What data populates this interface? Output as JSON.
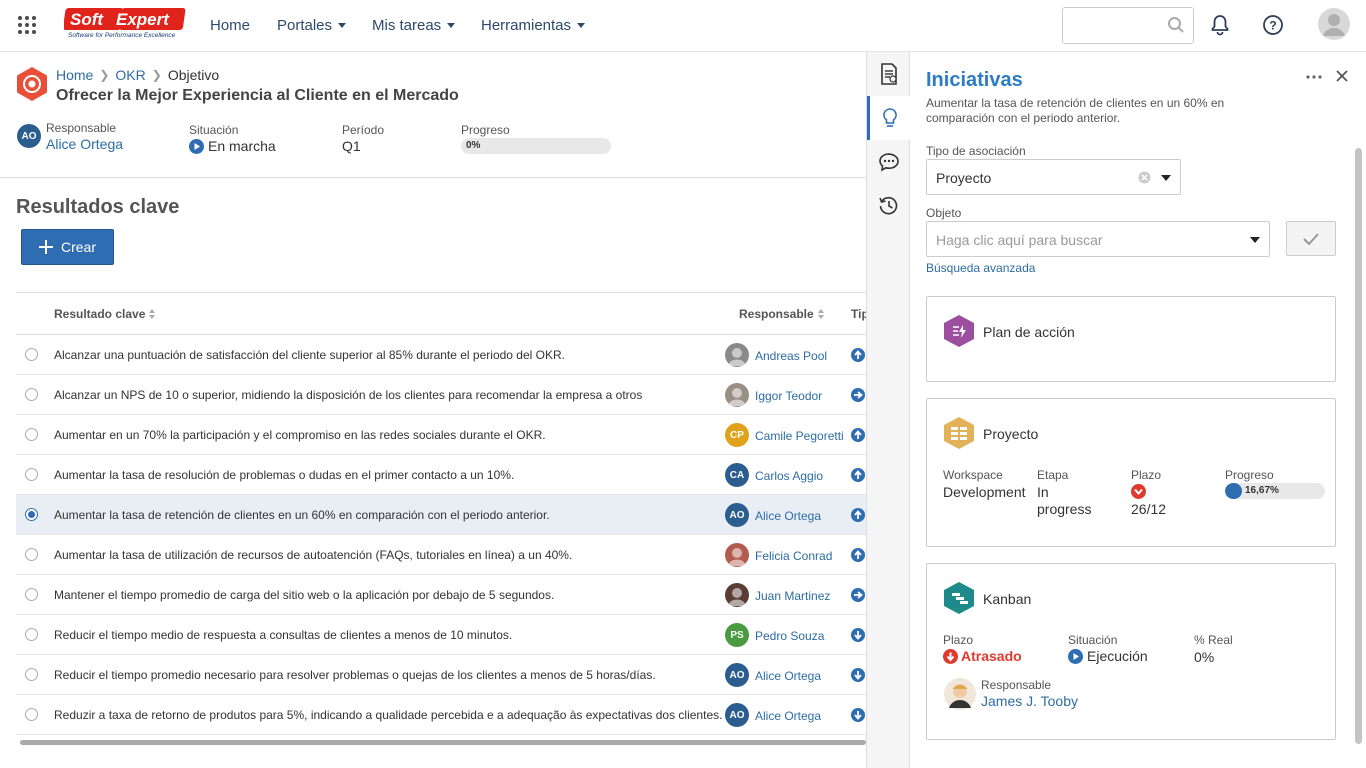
{
  "header": {
    "logo_main": "SoftExpert",
    "logo_tagline": "Software for Performance Excellence",
    "nav": [
      {
        "label": "Home",
        "has_menu": false
      },
      {
        "label": "Portales",
        "has_menu": true
      },
      {
        "label": "Mis tareas",
        "has_menu": true
      },
      {
        "label": "Herramientas",
        "has_menu": true
      }
    ],
    "search_placeholder": "",
    "icons": [
      "apps-grid-icon",
      "search-icon",
      "bell-icon",
      "help-icon",
      "user-avatar-icon"
    ]
  },
  "breadcrumb": {
    "home": "Home",
    "okr": "OKR",
    "current": "Objetivo"
  },
  "objective": {
    "title": "Ofrecer la Mejor Experiencia al Cliente en el Mercado",
    "responsable_label": "Responsable",
    "responsable_name": "Alice Ortega",
    "responsable_initials": "AO",
    "situacion_label": "Situación",
    "situacion_value": "En marcha",
    "periodo_label": "Período",
    "periodo_value": "Q1",
    "progreso_label": "Progreso",
    "progreso_value": "0%",
    "progreso_fraction": 0
  },
  "key_results": {
    "heading": "Resultados clave",
    "create_label": "Crear",
    "columns": {
      "result": "Resultado clave",
      "owner": "Responsable",
      "type": "Tip"
    },
    "rows": [
      {
        "text": "Alcanzar una puntuación de satisfacción del cliente superior al 85% durante el periodo del OKR.",
        "owner": "Andreas Pool",
        "initials": "",
        "avatar_color": "#8a8a8a",
        "type": "up",
        "selected": false
      },
      {
        "text": "Alcanzar un NPS de 10 o superior, midiendo la disposición de los clientes para recomendar la empresa a otros",
        "owner": "Iggor Teodor",
        "initials": "",
        "avatar_color": "#9a8f85",
        "type": "right",
        "selected": false
      },
      {
        "text": "Aumentar en un 70% la participación y el compromiso en las redes sociales durante el OKR.",
        "owner": "Camile Pegoretti",
        "initials": "CP",
        "avatar_color": "#e0a21b",
        "type": "up",
        "selected": false
      },
      {
        "text": "Aumentar la tasa de resolución de problemas o dudas en el primer contacto a un 10%.",
        "owner": "Carlos Aggio",
        "initials": "CA",
        "avatar_color": "#2b5d8f",
        "type": "up",
        "selected": false
      },
      {
        "text": "Aumentar la tasa de retención de clientes en un 60% en comparación con el periodo anterior.",
        "owner": "Alice Ortega",
        "initials": "AO",
        "avatar_color": "#2b5d8f",
        "type": "up",
        "selected": true
      },
      {
        "text": "Aumentar la tasa de utilización de recursos de autoatención (FAQs, tutoriales en línea) a un 40%.",
        "owner": "Felicia Conrad",
        "initials": "",
        "avatar_color": "#b35b4f",
        "type": "up",
        "selected": false
      },
      {
        "text": "Mantener el tiempo promedio de carga del sitio web o la aplicación por debajo de 5 segundos.",
        "owner": "Juan Martinez",
        "initials": "",
        "avatar_color": "#5a3e36",
        "type": "right",
        "selected": false
      },
      {
        "text": "Reducir el tiempo medio de respuesta a consultas de clientes a menos de 10 minutos.",
        "owner": "Pedro Souza",
        "initials": "PS",
        "avatar_color": "#4a9a3f",
        "type": "down",
        "selected": false
      },
      {
        "text": "Reducir el tiempo promedio necesario para resolver problemas o quejas de los clientes a menos de 5 horas/días.",
        "owner": "Alice Ortega",
        "initials": "AO",
        "avatar_color": "#2b5d8f",
        "type": "down",
        "selected": false
      },
      {
        "text": "Reduzir a taxa de retorno de produtos para 5%, indicando a qualidade percebida e a adequação às expectativas dos clientes.",
        "owner": "Alice Ortega",
        "initials": "AO",
        "avatar_color": "#2b5d8f",
        "type": "down",
        "selected": false
      }
    ]
  },
  "side_tabs": [
    "document-icon",
    "lightbulb-icon",
    "comments-icon",
    "history-icon"
  ],
  "panel": {
    "title": "Iniciativas",
    "subtitle": "Aumentar la tasa de retención de clientes en un 60% en comparación con el periodo anterior.",
    "tipo_label": "Tipo de asociación",
    "tipo_value": "Proyecto",
    "objeto_label": "Objeto",
    "objeto_placeholder": "Haga clic aquí para buscar",
    "advanced_search": "Búsqueda avanzada",
    "cards": {
      "plan": {
        "title": "Plan de acción",
        "color": "#9b4f9e"
      },
      "proyecto": {
        "title": "Proyecto",
        "color": "#e2b25a",
        "workspace_label": "Workspace",
        "workspace_value": "Development",
        "etapa_label": "Etapa",
        "etapa_value": "In progress",
        "plazo_label": "Plazo",
        "plazo_value": "26/12",
        "progreso_label": "Progreso",
        "progreso_value": "16,67%",
        "progreso_fraction": 0.1667
      },
      "kanban": {
        "title": "Kanban",
        "color": "#1f8a8a",
        "plazo_label": "Plazo",
        "plazo_value": "Atrasado",
        "situacion_label": "Situación",
        "situacion_value": "Ejecución",
        "real_label": "% Real",
        "real_value": "0%",
        "responsable_label": "Responsable",
        "responsable_value": "James J. Tooby"
      }
    }
  },
  "colors": {
    "accent": "#2f6db3",
    "link": "#2d6da3",
    "danger": "#e03a2f",
    "title_blue": "#2d7bc4"
  }
}
